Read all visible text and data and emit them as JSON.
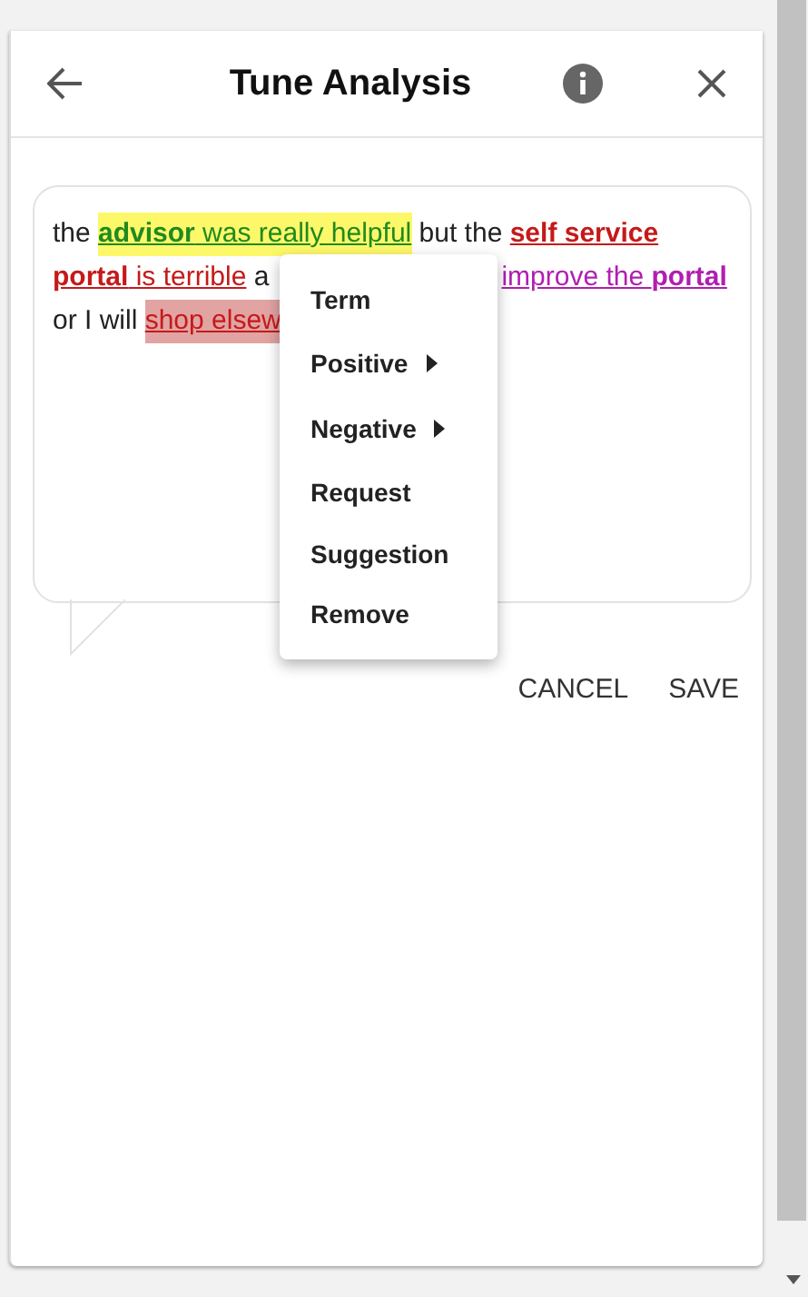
{
  "header": {
    "title": "Tune Analysis"
  },
  "annotated_text": {
    "lines": [
      [
        {
          "text": "the ",
          "kind": "plain",
          "highlighted": false
        },
        {
          "text": "**advisor** was really helpful",
          "kind": "positive",
          "highlighted": true
        },
        {
          "text": " but the ",
          "kind": "plain",
          "highlighted": false
        },
        {
          "text": "**self service**",
          "kind": "negative",
          "highlighted": false
        }
      ],
      [
        {
          "text": "**portal** is terrible",
          "kind": "negative",
          "highlighted": false
        },
        {
          "text": " a",
          "kind": "plain",
          "highlighted": false
        },
        {
          "text": "improve the **portal**",
          "kind": "request",
          "highlighted": false
        }
      ],
      [
        {
          "text": "or I will ",
          "kind": "plain",
          "highlighted": false
        },
        {
          "text": "shop elsew",
          "kind": "negative",
          "highlighted": true
        }
      ]
    ]
  },
  "context_menu": {
    "items": [
      {
        "label": "Term",
        "submenu": false
      },
      {
        "label": "Positive",
        "submenu": true
      },
      {
        "label": "Negative",
        "submenu": true
      },
      {
        "label": "Request",
        "submenu": false
      },
      {
        "label": "Suggestion",
        "submenu": false
      },
      {
        "label": "Remove",
        "submenu": false
      }
    ]
  },
  "actions": [
    "CANCEL",
    "SAVE"
  ]
}
